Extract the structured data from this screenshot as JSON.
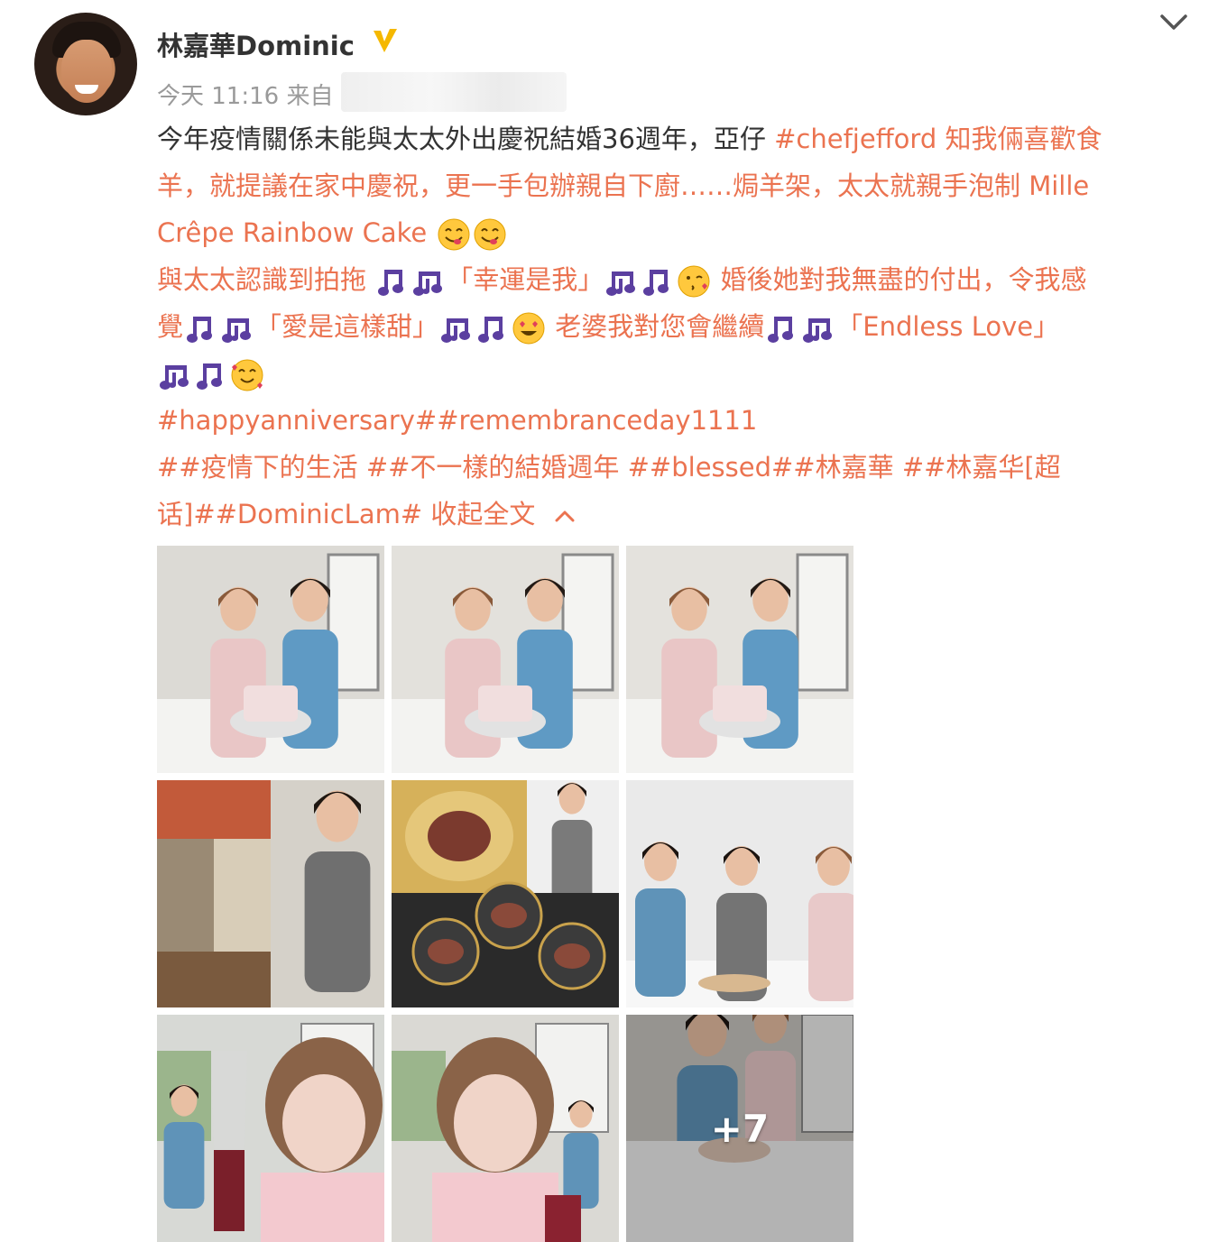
{
  "post": {
    "user": {
      "name": "林嘉華Dominic",
      "verified_icon": "verified-v-icon"
    },
    "meta": {
      "time": "今天 11:16 来自 ",
      "source_partial": "三"
    },
    "lines": [
      [
        {
          "t": "今年疫情關係未能與太太外出慶祝結婚36週年，亞仔 ",
          "c": "dark"
        },
        {
          "t": "#chefjefford 知我倆喜歡食",
          "c": "orange"
        }
      ],
      [
        {
          "t": "羊，就提議在家中慶祝，更一手包辦親自下廚……焗羊架，太太就親手泡制 Mille",
          "c": "orange"
        }
      ],
      [
        {
          "t": "Crêpe Rainbow Cake ",
          "c": "orange"
        }
      ],
      [
        {
          "t": "與太太認識到拍拖 ",
          "c": "orange"
        },
        {
          "t": "「幸運是我」",
          "c": "orange"
        },
        {
          "t": " 婚後她對我無盡的付出，令我感",
          "c": "orange"
        }
      ],
      [
        {
          "t": "覺",
          "c": "orange"
        },
        {
          "t": "「愛是這樣甜」",
          "c": "orange"
        },
        {
          "t": " 老婆我對您會繼續",
          "c": "orange"
        },
        {
          "t": "「Endless Love」",
          "c": "orange"
        }
      ],
      [],
      [
        {
          "t": "#happyanniversary##remembranceday1111",
          "c": "orange"
        }
      ],
      [
        {
          "t": "##疫情下的生活 ##不一樣的結婚週年 ##blessed##林嘉華 ##林嘉华[超",
          "c": "orange"
        }
      ],
      [
        {
          "t": "话]##DominicLam# 收起全文",
          "c": "orange"
        }
      ]
    ],
    "collapse_label": "收起全文",
    "more_photos": "+7"
  },
  "emoji_icons": [
    "yum-face-icon",
    "musical-notes-icon",
    "blow-kiss-face-icon",
    "heart-eyes-face-icon",
    "smiling-hearts-face-icon"
  ],
  "colors": {
    "text": "#333333",
    "link": "#eb7350",
    "meta": "#9a9a9a",
    "verified": "#f5b800",
    "emoji_music": "#5b3fa0",
    "emoji_face": "#ffc83d"
  },
  "photos": [
    {
      "name": "cake-couple-photo",
      "scene": "cake"
    },
    {
      "name": "cake-closeup-photo",
      "scene": "cake2"
    },
    {
      "name": "cutting-cake-photo",
      "scene": "cake3"
    },
    {
      "name": "cooking-collage-photo",
      "scene": "cook"
    },
    {
      "name": "lamb-dishes-photo",
      "scene": "lamb"
    },
    {
      "name": "dinner-table-photo",
      "scene": "table"
    },
    {
      "name": "wine-selfie-photo",
      "scene": "wine"
    },
    {
      "name": "wife-selfie-photo",
      "scene": "selfie"
    },
    {
      "name": "more-photos-tile",
      "scene": "more"
    }
  ]
}
